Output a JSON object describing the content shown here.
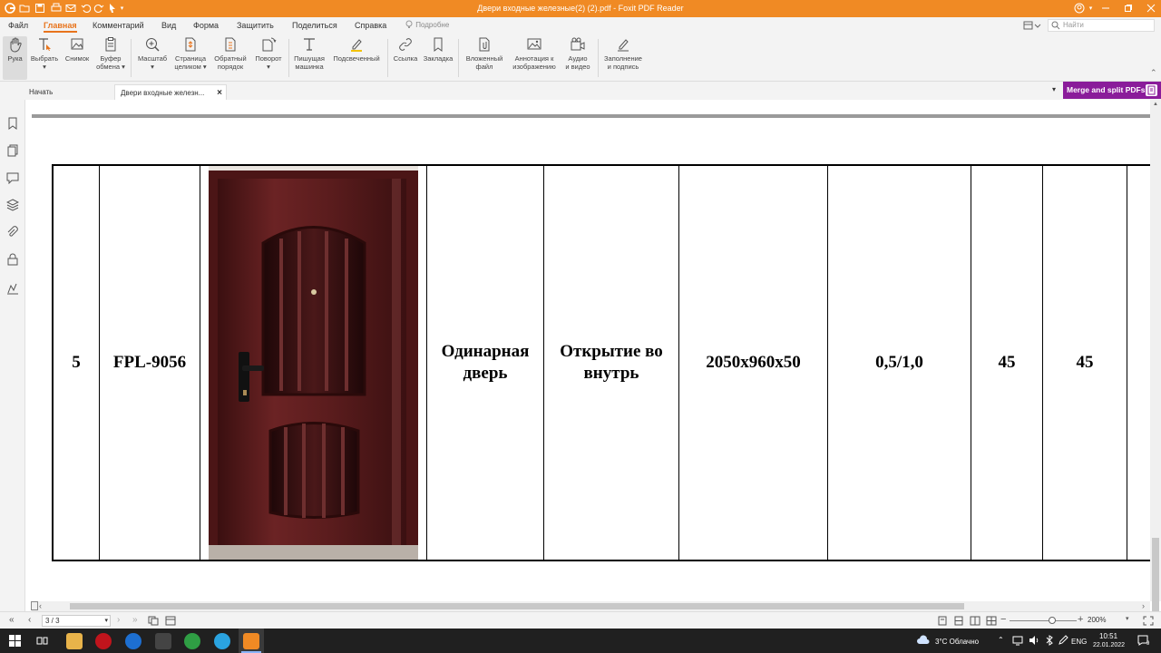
{
  "window": {
    "title": "Двери входные железные(2) (2).pdf - Foxit PDF Reader"
  },
  "menu": {
    "items": [
      "Файл",
      "Главная",
      "Комментарий",
      "Вид",
      "Форма",
      "Защитить",
      "Поделиться",
      "Справка"
    ],
    "active": "Главная",
    "hint_placeholder": "Подробне",
    "search_placeholder": "Найти"
  },
  "ribbon": {
    "buttons": [
      {
        "label1": "Рука",
        "label2": "",
        "icon": "hand-icon"
      },
      {
        "label1": "Выбрать",
        "label2": "▾",
        "icon": "select-text-icon"
      },
      {
        "label1": "Снимок",
        "label2": "",
        "icon": "snapshot-icon"
      },
      {
        "label1": "Буфер",
        "label2": "обмена ▾",
        "icon": "clipboard-icon"
      },
      {
        "label1": "Масштаб",
        "label2": "▾",
        "icon": "zoom-icon"
      },
      {
        "label1": "Страница",
        "label2": "целиком ▾",
        "icon": "fit-page-icon"
      },
      {
        "label1": "Обратный",
        "label2": "порядок",
        "icon": "reverse-order-icon"
      },
      {
        "label1": "Поворот",
        "label2": "▾",
        "icon": "rotate-icon"
      },
      {
        "label1": "Пишущая",
        "label2": "машинка",
        "icon": "typewriter-icon"
      },
      {
        "label1": "Подсвеченный",
        "label2": "",
        "icon": "highlight-icon"
      },
      {
        "label1": "Ссылка",
        "label2": "",
        "icon": "link-icon"
      },
      {
        "label1": "Закладка",
        "label2": "",
        "icon": "bookmark-icon"
      },
      {
        "label1": "Вложенный",
        "label2": "файл",
        "icon": "attachment-file-icon"
      },
      {
        "label1": "Аннотация к",
        "label2": "изображению",
        "icon": "image-annotation-icon"
      },
      {
        "label1": "Аудио",
        "label2": "и видео",
        "icon": "audio-video-icon"
      },
      {
        "label1": "Заполнение",
        "label2": "и подпись",
        "icon": "fill-sign-icon"
      }
    ]
  },
  "tabs": {
    "start": "Начать",
    "document": "Двери входные железн...",
    "close": "×"
  },
  "promo": {
    "label": "Merge and split PDFs"
  },
  "table_row": {
    "number": "5",
    "model": "FPL-9056",
    "image_alt": "door-photo",
    "type_line1": "Одинарная",
    "type_line2": "дверь",
    "opening_line1": "Открытие во",
    "opening_line2": "внутрь",
    "size": "2050x960x50",
    "thickness": "0,5/1,0",
    "col_a": "45",
    "col_b": "45"
  },
  "status": {
    "page": "3 / 3",
    "zoom": "200%"
  },
  "taskbar": {
    "weather": "3°C  Облачно",
    "lang": "ENG",
    "time": "10:51",
    "date": "22.01.2022",
    "notif": "9"
  },
  "colors": {
    "titlebar": "#f08a24",
    "accent": "#e8741c",
    "promo": "#8a1c9a",
    "door": "#5a1e1e"
  }
}
